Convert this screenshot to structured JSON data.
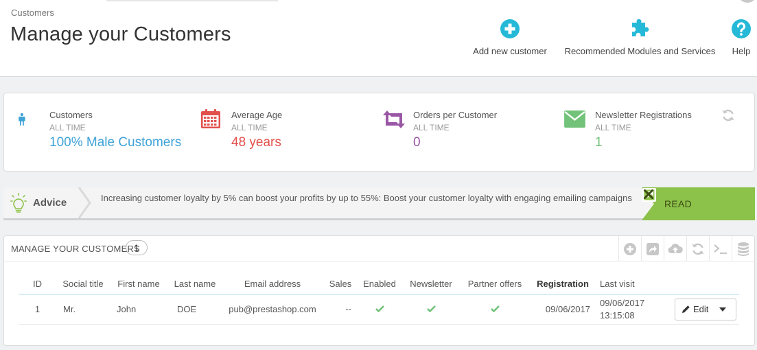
{
  "header": {
    "breadcrumb": "Customers",
    "title": "Manage your Customers",
    "toolbar": [
      {
        "label": "Add new customer",
        "icon": "plus-circle-icon"
      },
      {
        "label": "Recommended Modules and Services",
        "icon": "puzzle-icon"
      },
      {
        "label": "Help",
        "icon": "help-circle-icon"
      }
    ]
  },
  "kpis": [
    {
      "title": "Customers",
      "period": "ALL TIME",
      "value": "100% Male Customers",
      "icon": "male-user-icon",
      "color": "#3fa3d8"
    },
    {
      "title": "Average Age",
      "period": "ALL TIME",
      "value": "48 years",
      "icon": "calendar-icon",
      "color": "#e2504c"
    },
    {
      "title": "Orders per Customer",
      "period": "ALL TIME",
      "value": "0",
      "icon": "retweet-icon",
      "color": "#9a57a5"
    },
    {
      "title": "Newsletter Registrations",
      "period": "ALL TIME",
      "value": "1",
      "icon": "envelope-icon",
      "color": "#72c279"
    }
  ],
  "advice": {
    "label": "Advice",
    "text": "Increasing customer loyalty by 5% can boost your profits by up to 55%: Boost your customer loyalty with engaging emailing campaigns",
    "read_label": "READ",
    "accent": "#8dc24a"
  },
  "list": {
    "title": "Manage your Customers",
    "count": "1",
    "columns": [
      "ID",
      "Social title",
      "First name",
      "Last name",
      "Email address",
      "Sales",
      "Enabled",
      "Newsletter",
      "Partner offers",
      "Registration",
      "Last visit"
    ],
    "rows": [
      {
        "id": "1",
        "social_title": "Mr.",
        "first_name": "John",
        "last_name": "DOE",
        "email": "pub@prestashop.com",
        "sales": "--",
        "registration": "09/06/2017",
        "last_visit_date": "09/06/2017",
        "last_visit_time": "13:15:08",
        "edit_label": "Edit"
      }
    ]
  }
}
